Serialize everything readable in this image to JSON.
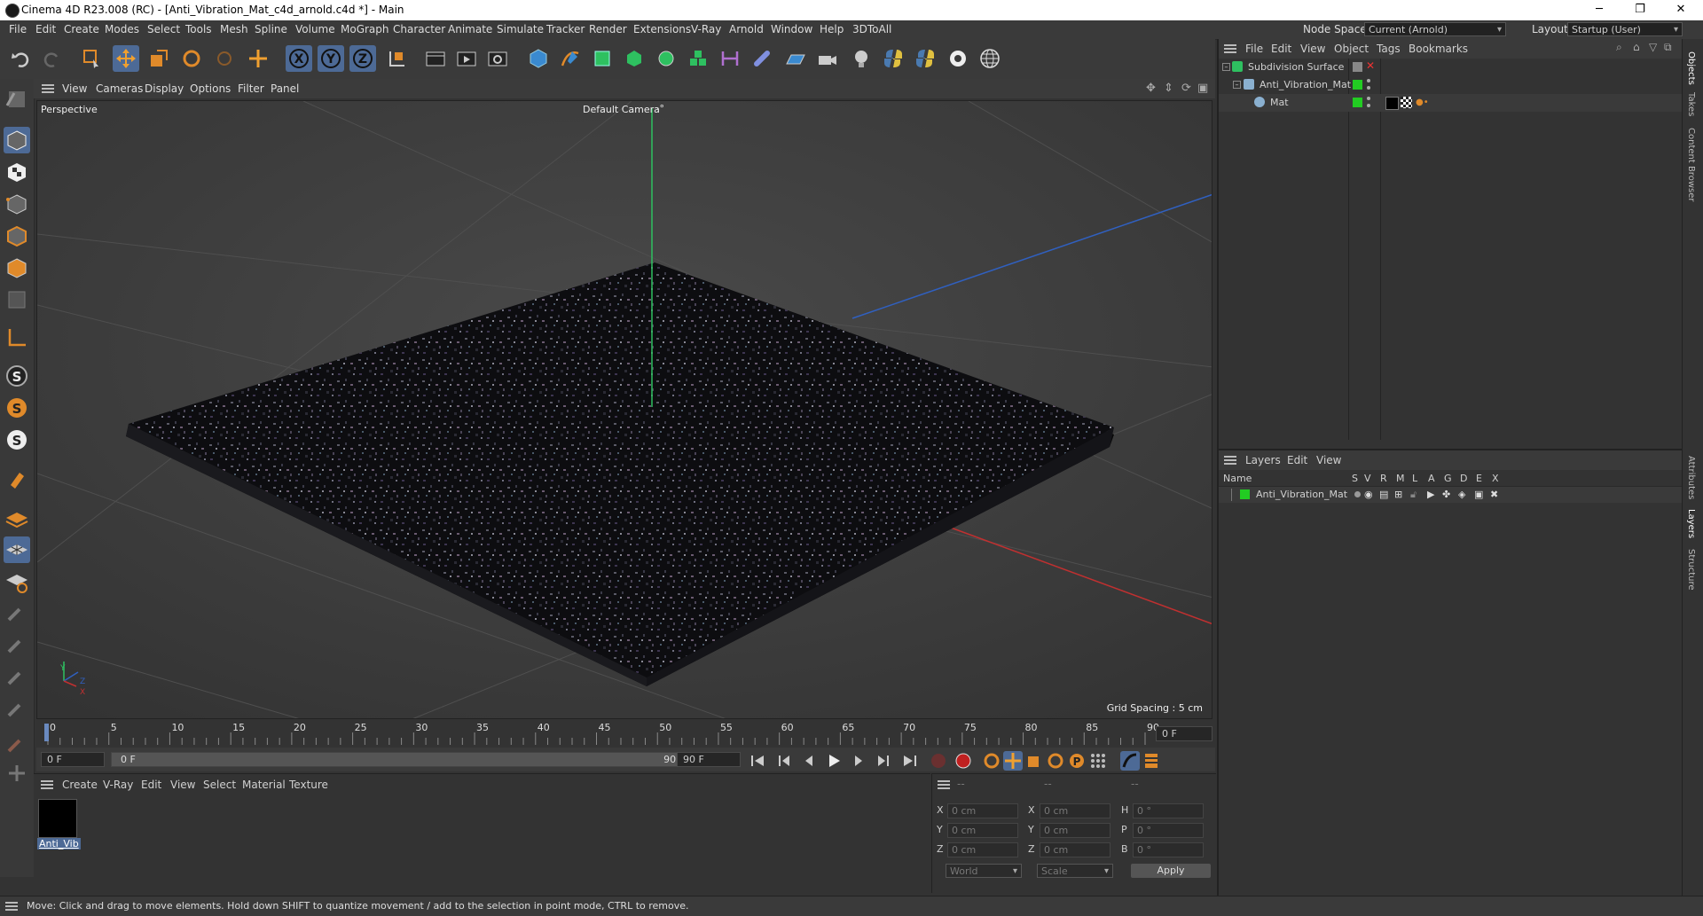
{
  "window": {
    "title": "Cinema 4D R23.008 (RC) - [Anti_Vibration_Mat_c4d_arnold.c4d *] - Main",
    "minimize": "─",
    "maximize": "❐",
    "close": "✕"
  },
  "menubar": {
    "items": [
      "File",
      "Edit",
      "Create",
      "Modes",
      "Select",
      "Tools",
      "Mesh",
      "Spline",
      "Volume",
      "MoGraph",
      "Character",
      "Animate",
      "Simulate",
      "Tracker",
      "Render",
      "Extensions",
      "V-Ray",
      "Arnold",
      "Window",
      "Help",
      "3DToAll"
    ],
    "node_space_label": "Node Space:",
    "node_space_value": "Current (Arnold)",
    "layout_label": "Layout:",
    "layout_value": "Startup (User)"
  },
  "viewport": {
    "menu": [
      "View",
      "Cameras",
      "Display",
      "Options",
      "Filter",
      "Panel"
    ],
    "projection": "Perspective",
    "camera": "Default Camera",
    "camera_suffix": "·°",
    "grid_spacing": "Grid Spacing : 5 cm",
    "axis_y": "Y",
    "axis_z": "Z",
    "axis_x": "X"
  },
  "timeline": {
    "ticks": [
      "0",
      "5",
      "10",
      "15",
      "20",
      "25",
      "30",
      "35",
      "40",
      "45",
      "50",
      "55",
      "60",
      "65",
      "70",
      "75",
      "80",
      "85",
      "90"
    ],
    "current_frame": "0 F",
    "start_field": "0 F",
    "range_start": "0 F",
    "range_end": "90 F",
    "end_field": "90 F"
  },
  "material_panel": {
    "menu": [
      "Create",
      "V-Ray",
      "Edit",
      "View",
      "Select",
      "Material",
      "Texture"
    ],
    "materials": [
      {
        "name": "Anti_Vib",
        "color": "#000000"
      }
    ]
  },
  "coord_panel": {
    "headers": [
      "--",
      "--",
      "--"
    ],
    "rows": [
      {
        "l1": "X",
        "v1": "0 cm",
        "l2": "X",
        "v2": "0 cm",
        "l3": "H",
        "v3": "0 °"
      },
      {
        "l1": "Y",
        "v1": "0 cm",
        "l2": "Y",
        "v2": "0 cm",
        "l3": "P",
        "v3": "0 °"
      },
      {
        "l1": "Z",
        "v1": "0 cm",
        "l2": "Z",
        "v2": "0 cm",
        "l3": "B",
        "v3": "0 °"
      }
    ],
    "coord_system": "World",
    "size_mode": "Scale",
    "apply": "Apply"
  },
  "objects_panel": {
    "menu": [
      "File",
      "Edit",
      "View",
      "Object",
      "Tags",
      "Bookmarks"
    ],
    "items": [
      {
        "name": "Subdivision Surface",
        "indent": 0
      },
      {
        "name": "Anti_Vibration_Mat",
        "indent": 1
      },
      {
        "name": "Mat",
        "indent": 2
      }
    ]
  },
  "layers_panel": {
    "menu": [
      "Layers",
      "Edit",
      "View"
    ],
    "name_header": "Name",
    "columns": [
      "S",
      "V",
      "R",
      "M",
      "L",
      "A",
      "G",
      "D",
      "E",
      "X"
    ],
    "layers": [
      {
        "name": "Anti_Vibration_Mat",
        "color": "#22cc22"
      }
    ]
  },
  "side_tabs": [
    "Objects",
    "Takes",
    "Content Browser",
    "Attributes",
    "Layers",
    "Structure"
  ],
  "status": "Move: Click and drag to move elements. Hold down SHIFT to quantize movement / add to the selection in point mode, CTRL to remove.",
  "colors": {
    "accent": "#4d6a96",
    "green_tag": "#22cc22",
    "axis_x": "#c03030",
    "axis_y": "#2ec060",
    "axis_z": "#3060c0"
  }
}
